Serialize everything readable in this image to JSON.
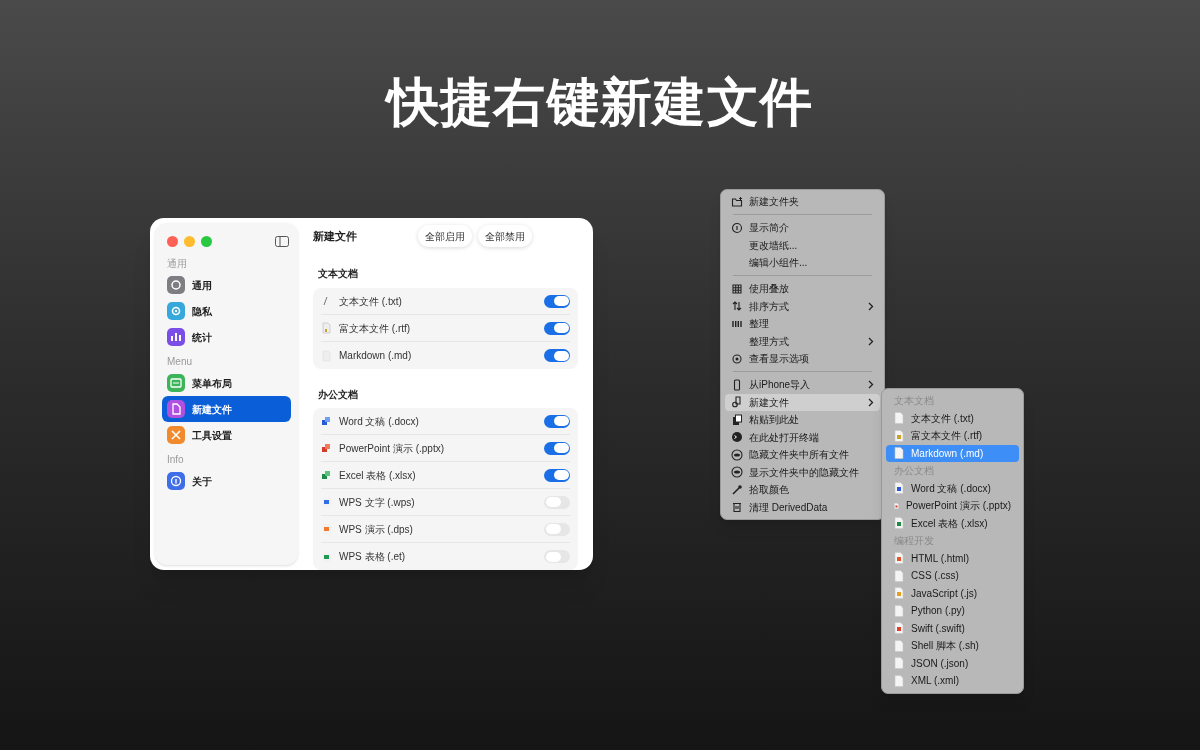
{
  "headline": "快捷右键新建文件",
  "sidebar": {
    "sections": [
      {
        "label": "通用",
        "items": [
          {
            "label": "通用",
            "selected": false
          },
          {
            "label": "隐私",
            "selected": false
          },
          {
            "label": "统计",
            "selected": false
          }
        ]
      },
      {
        "label": "Menu",
        "items": [
          {
            "label": "菜单布局",
            "selected": false
          },
          {
            "label": "新建文件",
            "selected": true
          },
          {
            "label": "工具设置",
            "selected": false
          }
        ]
      },
      {
        "label": "Info",
        "items": [
          {
            "label": "关于",
            "selected": false
          }
        ]
      }
    ]
  },
  "main": {
    "title": "新建文件",
    "buttons": [
      "全部启用",
      "全部禁用"
    ],
    "groups": [
      {
        "label": "文本文档",
        "rows": [
          {
            "label": "文本文件 (.txt)",
            "on": true
          },
          {
            "label": "富文本文件 (.rtf)",
            "on": true
          },
          {
            "label": "Markdown (.md)",
            "on": true
          }
        ]
      },
      {
        "label": "办公文档",
        "rows": [
          {
            "label": "Word 文稿 (.docx)",
            "on": true
          },
          {
            "label": "PowerPoint 演示 (.pptx)",
            "on": true
          },
          {
            "label": "Excel 表格 (.xlsx)",
            "on": true
          },
          {
            "label": "WPS 文字 (.wps)",
            "on": false
          },
          {
            "label": "WPS 演示 (.dps)",
            "on": false
          },
          {
            "label": "WPS 表格 (.et)",
            "on": false
          }
        ]
      }
    ]
  },
  "context_menu": {
    "items": [
      {
        "kind": "item",
        "label": "新建文件夹",
        "submenu": false,
        "selected": false
      },
      {
        "kind": "separator"
      },
      {
        "kind": "item",
        "label": "显示简介",
        "submenu": false,
        "selected": false
      },
      {
        "kind": "item",
        "label": "更改墙纸...",
        "submenu": false,
        "selected": false
      },
      {
        "kind": "item",
        "label": "编辑小组件...",
        "submenu": false,
        "selected": false
      },
      {
        "kind": "separator"
      },
      {
        "kind": "item",
        "label": "使用叠放",
        "submenu": false,
        "selected": false
      },
      {
        "kind": "item",
        "label": "排序方式",
        "submenu": true,
        "selected": false
      },
      {
        "kind": "item",
        "label": "整理",
        "submenu": false,
        "selected": false
      },
      {
        "kind": "item",
        "label": "整理方式",
        "submenu": true,
        "selected": false
      },
      {
        "kind": "item",
        "label": "查看显示选项",
        "submenu": false,
        "selected": false
      },
      {
        "kind": "separator"
      },
      {
        "kind": "item",
        "label": "从iPhone导入",
        "submenu": true,
        "selected": false
      },
      {
        "kind": "item",
        "label": "新建文件",
        "submenu": true,
        "selected": true
      },
      {
        "kind": "item",
        "label": "粘贴到此处",
        "submenu": false,
        "selected": false
      },
      {
        "kind": "item",
        "label": "在此处打开终端",
        "submenu": false,
        "selected": false
      },
      {
        "kind": "item",
        "label": "隐藏文件夹中所有文件",
        "submenu": false,
        "selected": false
      },
      {
        "kind": "item",
        "label": "显示文件夹中的隐藏文件",
        "submenu": false,
        "selected": false
      },
      {
        "kind": "item",
        "label": "拾取颜色",
        "submenu": false,
        "selected": false
      },
      {
        "kind": "item",
        "label": "清理 DerivedData",
        "submenu": false,
        "selected": false
      }
    ]
  },
  "submenu": {
    "items": [
      {
        "kind": "header",
        "label": "文本文档"
      },
      {
        "kind": "item",
        "label": "文本文件 (.txt)",
        "selected": false
      },
      {
        "kind": "item",
        "label": "富文本文件 (.rtf)",
        "selected": false
      },
      {
        "kind": "item",
        "label": "Markdown (.md)",
        "selected": true
      },
      {
        "kind": "header",
        "label": "办公文档"
      },
      {
        "kind": "item",
        "label": "Word 文稿 (.docx)",
        "selected": false
      },
      {
        "kind": "item",
        "label": "PowerPoint 演示 (.pptx)",
        "selected": false
      },
      {
        "kind": "item",
        "label": "Excel 表格 (.xlsx)",
        "selected": false
      },
      {
        "kind": "header",
        "label": "编程开发"
      },
      {
        "kind": "item",
        "label": "HTML (.html)",
        "selected": false
      },
      {
        "kind": "item",
        "label": "CSS (.css)",
        "selected": false
      },
      {
        "kind": "item",
        "label": "JavaScript (.js)",
        "selected": false
      },
      {
        "kind": "item",
        "label": "Python (.py)",
        "selected": false
      },
      {
        "kind": "item",
        "label": "Swift (.swift)",
        "selected": false
      },
      {
        "kind": "item",
        "label": "Shell 脚本 (.sh)",
        "selected": false
      },
      {
        "kind": "item",
        "label": "JSON (.json)",
        "selected": false
      },
      {
        "kind": "item",
        "label": "XML (.xml)",
        "selected": false
      }
    ]
  }
}
